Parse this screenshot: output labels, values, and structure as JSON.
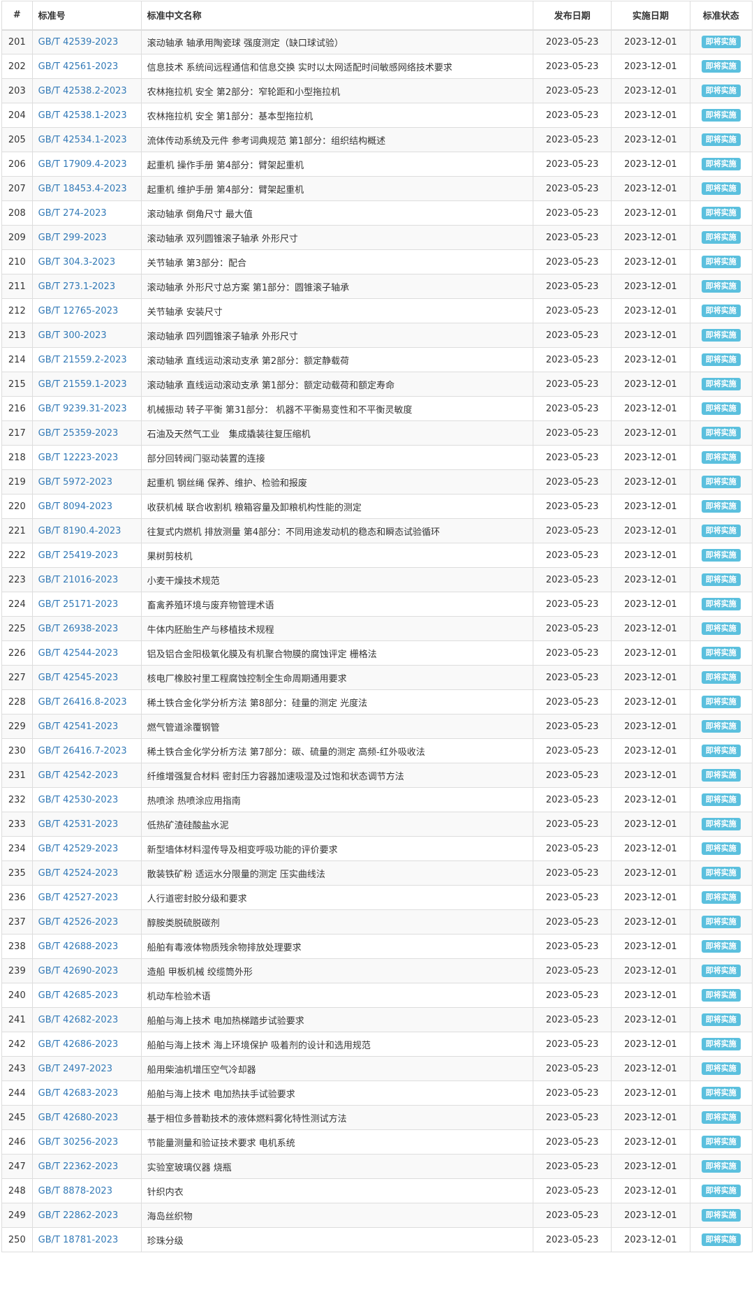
{
  "table": {
    "headers": [
      "#",
      "标准号",
      "标准中文名称",
      "发布日期",
      "实施日期",
      "标准状态"
    ],
    "rows": [
      {
        "idx": "201",
        "code": "GB/T 42539-2023",
        "name": "滚动轴承 轴承用陶瓷球 强度测定（缺口球试验）",
        "pub": "2023-05-23",
        "impl": "2023-12-01",
        "status": "即将实施"
      },
      {
        "idx": "202",
        "code": "GB/T 42561-2023",
        "name": "信息技术 系统间远程通信和信息交换 实时以太网适配时间敏感网络技术要求",
        "pub": "2023-05-23",
        "impl": "2023-12-01",
        "status": "即将实施"
      },
      {
        "idx": "203",
        "code": "GB/T 42538.2-2023",
        "name": "农林拖拉机 安全 第2部分：窄轮距和小型拖拉机",
        "pub": "2023-05-23",
        "impl": "2023-12-01",
        "status": "即将实施"
      },
      {
        "idx": "204",
        "code": "GB/T 42538.1-2023",
        "name": "农林拖拉机 安全 第1部分：基本型拖拉机",
        "pub": "2023-05-23",
        "impl": "2023-12-01",
        "status": "即将实施"
      },
      {
        "idx": "205",
        "code": "GB/T 42534.1-2023",
        "name": "流体传动系统及元件 参考词典规范 第1部分：组织结构概述",
        "pub": "2023-05-23",
        "impl": "2023-12-01",
        "status": "即将实施"
      },
      {
        "idx": "206",
        "code": "GB/T 17909.4-2023",
        "name": "起重机 操作手册 第4部分：臂架起重机",
        "pub": "2023-05-23",
        "impl": "2023-12-01",
        "status": "即将实施"
      },
      {
        "idx": "207",
        "code": "GB/T 18453.4-2023",
        "name": "起重机 维护手册 第4部分：臂架起重机",
        "pub": "2023-05-23",
        "impl": "2023-12-01",
        "status": "即将实施"
      },
      {
        "idx": "208",
        "code": "GB/T 274-2023",
        "name": "滚动轴承 倒角尺寸 最大值",
        "pub": "2023-05-23",
        "impl": "2023-12-01",
        "status": "即将实施"
      },
      {
        "idx": "209",
        "code": "GB/T 299-2023",
        "name": "滚动轴承 双列圆锥滚子轴承 外形尺寸",
        "pub": "2023-05-23",
        "impl": "2023-12-01",
        "status": "即将实施"
      },
      {
        "idx": "210",
        "code": "GB/T 304.3-2023",
        "name": "关节轴承 第3部分：配合",
        "pub": "2023-05-23",
        "impl": "2023-12-01",
        "status": "即将实施"
      },
      {
        "idx": "211",
        "code": "GB/T 273.1-2023",
        "name": "滚动轴承 外形尺寸总方案 第1部分：圆锥滚子轴承",
        "pub": "2023-05-23",
        "impl": "2023-12-01",
        "status": "即将实施"
      },
      {
        "idx": "212",
        "code": "GB/T 12765-2023",
        "name": "关节轴承 安装尺寸",
        "pub": "2023-05-23",
        "impl": "2023-12-01",
        "status": "即将实施"
      },
      {
        "idx": "213",
        "code": "GB/T 300-2023",
        "name": "滚动轴承 四列圆锥滚子轴承 外形尺寸",
        "pub": "2023-05-23",
        "impl": "2023-12-01",
        "status": "即将实施"
      },
      {
        "idx": "214",
        "code": "GB/T 21559.2-2023",
        "name": "滚动轴承 直线运动滚动支承 第2部分：额定静载荷",
        "pub": "2023-05-23",
        "impl": "2023-12-01",
        "status": "即将实施"
      },
      {
        "idx": "215",
        "code": "GB/T 21559.1-2023",
        "name": "滚动轴承 直线运动滚动支承 第1部分：额定动载荷和额定寿命",
        "pub": "2023-05-23",
        "impl": "2023-12-01",
        "status": "即将实施"
      },
      {
        "idx": "216",
        "code": "GB/T 9239.31-2023",
        "name": "机械振动 转子平衡 第31部分： 机器不平衡易变性和不平衡灵敏度",
        "pub": "2023-05-23",
        "impl": "2023-12-01",
        "status": "即将实施"
      },
      {
        "idx": "217",
        "code": "GB/T 25359-2023",
        "name": "石油及天然气工业　集成撬装往复压缩机",
        "pub": "2023-05-23",
        "impl": "2023-12-01",
        "status": "即将实施"
      },
      {
        "idx": "218",
        "code": "GB/T 12223-2023",
        "name": "部分回转阀门驱动装置的连接",
        "pub": "2023-05-23",
        "impl": "2023-12-01",
        "status": "即将实施"
      },
      {
        "idx": "219",
        "code": "GB/T 5972-2023",
        "name": "起重机 钢丝绳 保养、维护、检验和报废",
        "pub": "2023-05-23",
        "impl": "2023-12-01",
        "status": "即将实施"
      },
      {
        "idx": "220",
        "code": "GB/T 8094-2023",
        "name": "收获机械 联合收割机 粮箱容量及卸粮机构性能的测定",
        "pub": "2023-05-23",
        "impl": "2023-12-01",
        "status": "即将实施"
      },
      {
        "idx": "221",
        "code": "GB/T 8190.4-2023",
        "name": "往复式内燃机 排放测量 第4部分：不同用途发动机的稳态和瞬态试验循环",
        "pub": "2023-05-23",
        "impl": "2023-12-01",
        "status": "即将实施"
      },
      {
        "idx": "222",
        "code": "GB/T 25419-2023",
        "name": "果树剪枝机",
        "pub": "2023-05-23",
        "impl": "2023-12-01",
        "status": "即将实施"
      },
      {
        "idx": "223",
        "code": "GB/T 21016-2023",
        "name": "小麦干燥技术规范",
        "pub": "2023-05-23",
        "impl": "2023-12-01",
        "status": "即将实施"
      },
      {
        "idx": "224",
        "code": "GB/T 25171-2023",
        "name": "畜禽养殖环境与废弃物管理术语",
        "pub": "2023-05-23",
        "impl": "2023-12-01",
        "status": "即将实施"
      },
      {
        "idx": "225",
        "code": "GB/T 26938-2023",
        "name": "牛体内胚胎生产与移植技术规程",
        "pub": "2023-05-23",
        "impl": "2023-12-01",
        "status": "即将实施"
      },
      {
        "idx": "226",
        "code": "GB/T 42544-2023",
        "name": "铝及铝合金阳极氧化膜及有机聚合物膜的腐蚀评定 栅格法",
        "pub": "2023-05-23",
        "impl": "2023-12-01",
        "status": "即将实施"
      },
      {
        "idx": "227",
        "code": "GB/T 42545-2023",
        "name": "核电厂橡胶衬里工程腐蚀控制全生命周期通用要求",
        "pub": "2023-05-23",
        "impl": "2023-12-01",
        "status": "即将实施"
      },
      {
        "idx": "228",
        "code": "GB/T 26416.8-2023",
        "name": "稀土铁合金化学分析方法 第8部分：硅量的测定 光度法",
        "pub": "2023-05-23",
        "impl": "2023-12-01",
        "status": "即将实施"
      },
      {
        "idx": "229",
        "code": "GB/T 42541-2023",
        "name": "燃气管道涂覆钢管",
        "pub": "2023-05-23",
        "impl": "2023-12-01",
        "status": "即将实施"
      },
      {
        "idx": "230",
        "code": "GB/T 26416.7-2023",
        "name": "稀土铁合金化学分析方法 第7部分：碳、硫量的测定 高频-红外吸收法",
        "pub": "2023-05-23",
        "impl": "2023-12-01",
        "status": "即将实施"
      },
      {
        "idx": "231",
        "code": "GB/T 42542-2023",
        "name": "纤维增强复合材料 密封压力容器加速吸湿及过饱和状态调节方法",
        "pub": "2023-05-23",
        "impl": "2023-12-01",
        "status": "即将实施"
      },
      {
        "idx": "232",
        "code": "GB/T 42530-2023",
        "name": "热喷涂 热喷涂应用指南",
        "pub": "2023-05-23",
        "impl": "2023-12-01",
        "status": "即将实施"
      },
      {
        "idx": "233",
        "code": "GB/T 42531-2023",
        "name": "低热矿渣硅酸盐水泥",
        "pub": "2023-05-23",
        "impl": "2023-12-01",
        "status": "即将实施"
      },
      {
        "idx": "234",
        "code": "GB/T 42529-2023",
        "name": "新型墙体材料湿传导及相变呼吸功能的评价要求",
        "pub": "2023-05-23",
        "impl": "2023-12-01",
        "status": "即将实施"
      },
      {
        "idx": "235",
        "code": "GB/T 42524-2023",
        "name": "散装铁矿粉 适运水分限量的测定 压实曲线法",
        "pub": "2023-05-23",
        "impl": "2023-12-01",
        "status": "即将实施"
      },
      {
        "idx": "236",
        "code": "GB/T 42527-2023",
        "name": "人行道密封胶分级和要求",
        "pub": "2023-05-23",
        "impl": "2023-12-01",
        "status": "即将实施"
      },
      {
        "idx": "237",
        "code": "GB/T 42526-2023",
        "name": "醇胺类脱硫脱碳剂",
        "pub": "2023-05-23",
        "impl": "2023-12-01",
        "status": "即将实施"
      },
      {
        "idx": "238",
        "code": "GB/T 42688-2023",
        "name": "船舶有毒液体物质残余物排放处理要求",
        "pub": "2023-05-23",
        "impl": "2023-12-01",
        "status": "即将实施"
      },
      {
        "idx": "239",
        "code": "GB/T 42690-2023",
        "name": "造船 甲板机械 绞缆筒外形",
        "pub": "2023-05-23",
        "impl": "2023-12-01",
        "status": "即将实施"
      },
      {
        "idx": "240",
        "code": "GB/T 42685-2023",
        "name": "机动车检验术语",
        "pub": "2023-05-23",
        "impl": "2023-12-01",
        "status": "即将实施"
      },
      {
        "idx": "241",
        "code": "GB/T 42682-2023",
        "name": "船舶与海上技术 电加热梯踏步试验要求",
        "pub": "2023-05-23",
        "impl": "2023-12-01",
        "status": "即将实施"
      },
      {
        "idx": "242",
        "code": "GB/T 42686-2023",
        "name": "船舶与海上技术 海上环境保护 吸着剂的设计和选用规范",
        "pub": "2023-05-23",
        "impl": "2023-12-01",
        "status": "即将实施"
      },
      {
        "idx": "243",
        "code": "GB/T 2497-2023",
        "name": "船用柴油机增压空气冷却器",
        "pub": "2023-05-23",
        "impl": "2023-12-01",
        "status": "即将实施"
      },
      {
        "idx": "244",
        "code": "GB/T 42683-2023",
        "name": "船舶与海上技术 电加热扶手试验要求",
        "pub": "2023-05-23",
        "impl": "2023-12-01",
        "status": "即将实施"
      },
      {
        "idx": "245",
        "code": "GB/T 42680-2023",
        "name": "基于相位多普勒技术的液体燃料雾化特性测试方法",
        "pub": "2023-05-23",
        "impl": "2023-12-01",
        "status": "即将实施"
      },
      {
        "idx": "246",
        "code": "GB/T 30256-2023",
        "name": "节能量测量和验证技术要求 电机系统",
        "pub": "2023-05-23",
        "impl": "2023-12-01",
        "status": "即将实施"
      },
      {
        "idx": "247",
        "code": "GB/T 22362-2023",
        "name": "实验室玻璃仪器 烧瓶",
        "pub": "2023-05-23",
        "impl": "2023-12-01",
        "status": "即将实施"
      },
      {
        "idx": "248",
        "code": "GB/T 8878-2023",
        "name": "针织内衣",
        "pub": "2023-05-23",
        "impl": "2023-12-01",
        "status": "即将实施"
      },
      {
        "idx": "249",
        "code": "GB/T 22862-2023",
        "name": "海岛丝织物",
        "pub": "2023-05-23",
        "impl": "2023-12-01",
        "status": "即将实施"
      },
      {
        "idx": "250",
        "code": "GB/T 18781-2023",
        "name": "珍珠分级",
        "pub": "2023-05-23",
        "impl": "2023-12-01",
        "status": "即将实施"
      }
    ]
  },
  "colors": {
    "link": "#337ab7",
    "badge": "#5bc0de",
    "border": "#dddddd",
    "stripe": "#f9f9f9"
  }
}
